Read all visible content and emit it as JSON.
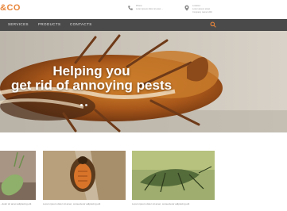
{
  "brand": {
    "logo_text": "&CO"
  },
  "header": {
    "phone_lines": [
      "Phone:",
      "Lorem ipsum dolor sit amet ..."
    ],
    "address_lines": [
      "Location:",
      "Lorem ipsum street",
      "Company name 1234"
    ]
  },
  "nav": {
    "items": [
      {
        "label": "SERVICES"
      },
      {
        "label": "PRODUCTS"
      },
      {
        "label": "CONTACTS"
      }
    ],
    "search_icon": "search-icon"
  },
  "hero": {
    "title_line1": "Helping you",
    "title_line2": "get rid of annoying pests",
    "slide_count": 2,
    "active_slide": 1
  },
  "cards": [
    {
      "caption": "...dolor sit amet adipiscing elit"
    },
    {
      "caption": "Lorem ipsum dolor sit amet, consectetur adipiscing elit"
    },
    {
      "caption": "Lorem ipsum dolor sit amet, consectetur adipiscing elit"
    }
  ],
  "icons": {
    "phone": "phone-icon",
    "location": "map-pin-icon"
  },
  "colors": {
    "accent": "#e8863c",
    "nav_bg": "#4a4a4a",
    "hero_text": "#ffffff"
  }
}
